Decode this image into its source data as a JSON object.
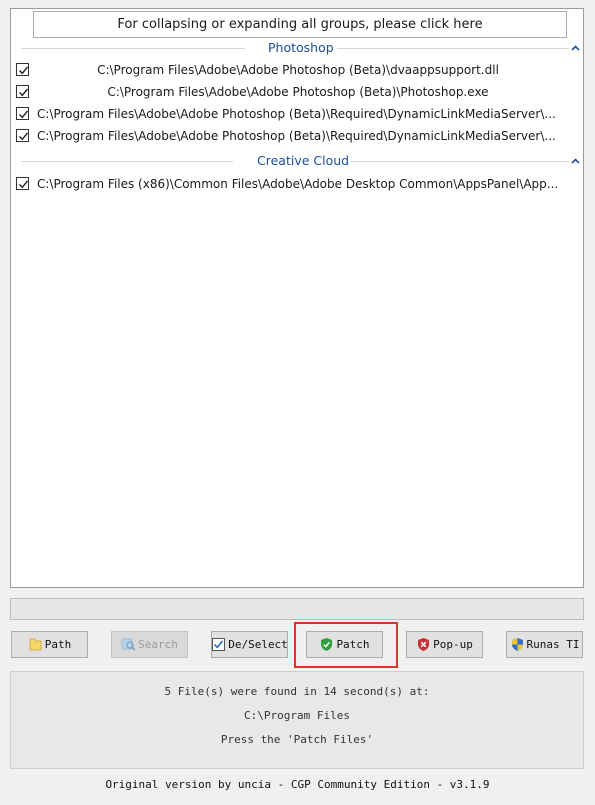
{
  "list": {
    "collapse_all_label": "For collapsing or expanding all groups, please click here",
    "groups": [
      {
        "title": "Photoshop",
        "files": [
          "C:\\Program Files\\Adobe\\Adobe Photoshop (Beta)\\dvaappsupport.dll",
          "C:\\Program Files\\Adobe\\Adobe Photoshop (Beta)\\Photoshop.exe",
          "C:\\Program Files\\Adobe\\Adobe Photoshop (Beta)\\Required\\DynamicLinkMediaServer\\...",
          "C:\\Program Files\\Adobe\\Adobe Photoshop (Beta)\\Required\\DynamicLinkMediaServer\\..."
        ]
      },
      {
        "title": "Creative Cloud",
        "files": [
          "C:\\Program Files (x86)\\Common Files\\Adobe\\Adobe Desktop Common\\AppsPanel\\App..."
        ]
      }
    ]
  },
  "buttons": {
    "path": "Path",
    "search": "Search",
    "deselect": "De/Select",
    "patch": "Patch",
    "popup": "Pop-up",
    "runas": "Runas TI"
  },
  "status": {
    "line1": "5 File(s) were found in 14 second(s) at:",
    "line2": "C:\\Program Files",
    "line3": "Press the 'Patch Files'"
  },
  "footer": "Original version by uncia - CGP Community Edition - v3.1.9",
  "colors": {
    "group_title": "#1d4ea1",
    "highlight": "#d9352b",
    "patch_shield": "#2e9e3e",
    "popup_shield": "#c8323a"
  }
}
